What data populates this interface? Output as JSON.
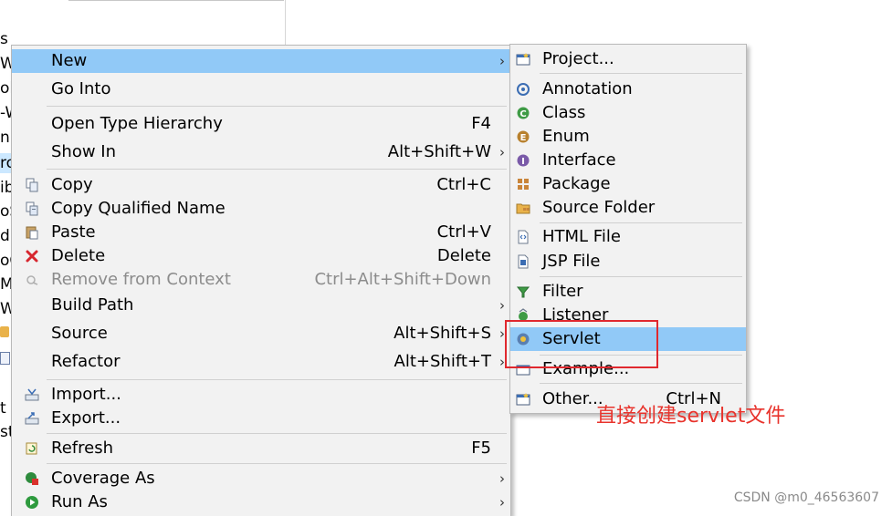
{
  "tree": {
    "fragments": [
      "s",
      "W",
      "olo",
      "-W",
      "n I",
      "ro",
      "ib",
      "oS",
      "d",
      "oC",
      "MI",
      "WI",
      "t",
      "st"
    ]
  },
  "main_menu": {
    "items": [
      {
        "label": "New",
        "shortcut": "",
        "submenu": true,
        "highlighted": true,
        "icon": ""
      },
      {
        "label": "Go Into",
        "shortcut": "",
        "submenu": false,
        "icon": ""
      },
      {
        "label": "Open Type Hierarchy",
        "shortcut": "F4",
        "submenu": false,
        "icon": ""
      },
      {
        "label": "Show In",
        "shortcut": "Alt+Shift+W",
        "submenu": true,
        "icon": ""
      },
      {
        "label": "Copy",
        "shortcut": "Ctrl+C",
        "submenu": false,
        "icon": "copy-icon"
      },
      {
        "label": "Copy Qualified Name",
        "shortcut": "",
        "submenu": false,
        "icon": "copy-qualified-name-icon"
      },
      {
        "label": "Paste",
        "shortcut": "Ctrl+V",
        "submenu": false,
        "icon": "paste-icon"
      },
      {
        "label": "Delete",
        "shortcut": "Delete",
        "submenu": false,
        "icon": "delete-icon"
      },
      {
        "label": "Remove from Context",
        "shortcut": "Ctrl+Alt+Shift+Down",
        "submenu": false,
        "disabled": true,
        "icon": "remove-context-icon"
      },
      {
        "label": "Build Path",
        "shortcut": "",
        "submenu": true,
        "icon": ""
      },
      {
        "label": "Source",
        "shortcut": "Alt+Shift+S",
        "submenu": true,
        "icon": ""
      },
      {
        "label": "Refactor",
        "shortcut": "Alt+Shift+T",
        "submenu": true,
        "icon": ""
      },
      {
        "label": "Import...",
        "shortcut": "",
        "submenu": false,
        "icon": "import-icon"
      },
      {
        "label": "Export...",
        "shortcut": "",
        "submenu": false,
        "icon": "export-icon"
      },
      {
        "label": "Refresh",
        "shortcut": "F5",
        "submenu": false,
        "icon": "refresh-icon"
      },
      {
        "label": "Coverage As",
        "shortcut": "",
        "submenu": true,
        "icon": "coverage-icon"
      },
      {
        "label": "Run As",
        "shortcut": "",
        "submenu": true,
        "icon": "run-icon"
      }
    ]
  },
  "sub_menu": {
    "items": [
      {
        "label": "Project...",
        "shortcut": "",
        "icon": "project-icon"
      },
      {
        "label": "Annotation",
        "shortcut": "",
        "icon": "annotation-icon"
      },
      {
        "label": "Class",
        "shortcut": "",
        "icon": "class-icon"
      },
      {
        "label": "Enum",
        "shortcut": "",
        "icon": "enum-icon"
      },
      {
        "label": "Interface",
        "shortcut": "",
        "icon": "interface-icon"
      },
      {
        "label": "Package",
        "shortcut": "",
        "icon": "package-icon"
      },
      {
        "label": "Source Folder",
        "shortcut": "",
        "icon": "source-folder-icon"
      },
      {
        "label": "HTML File",
        "shortcut": "",
        "icon": "html-file-icon"
      },
      {
        "label": "JSP File",
        "shortcut": "",
        "icon": "jsp-file-icon"
      },
      {
        "label": "Filter",
        "shortcut": "",
        "icon": "filter-icon"
      },
      {
        "label": "Listener",
        "shortcut": "",
        "icon": "listener-icon"
      },
      {
        "label": "Servlet",
        "shortcut": "",
        "highlighted": true,
        "icon": "servlet-icon"
      },
      {
        "label": "Example...",
        "shortcut": "",
        "icon": "example-icon"
      },
      {
        "label": "Other...",
        "shortcut": "Ctrl+N",
        "icon": "other-icon"
      }
    ]
  },
  "annotation": {
    "text": "直接创建servlet文件",
    "color": "#e8332c"
  },
  "watermark": "CSDN @m0_46563607",
  "colors": {
    "highlight": "#91c9f7",
    "menu_bg": "#f2f2f2",
    "annotation_red": "#e0282e"
  }
}
